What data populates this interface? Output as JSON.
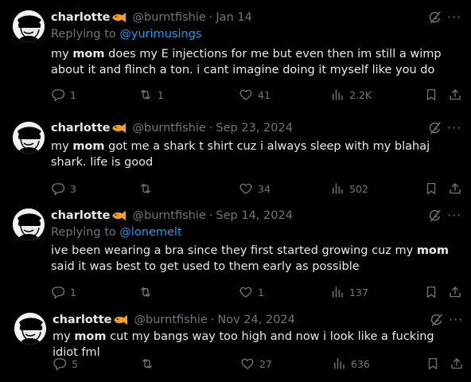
{
  "icons": {
    "reply": "reply-icon",
    "repost": "repost-icon",
    "like": "heart-icon",
    "views": "views-icon",
    "bookmark": "bookmark-icon",
    "share": "share-icon",
    "grok": "grok-icon",
    "more": "more-icon"
  },
  "tweets": [
    {
      "name": "charlotte",
      "handle": "@burntfishie",
      "date": "Jan 14",
      "replying_to_label": "Replying to",
      "replying_to_user": "@yurimusings",
      "text_before": "my ",
      "text_bold": "mom",
      "text_after": " does my E injections for me but even then im still a wimp about it and flinch a ton. i cant imagine doing it myself like you do",
      "replies": "1",
      "reposts": "1",
      "likes": "41",
      "views": "2.2K"
    },
    {
      "name": "charlotte",
      "handle": "@burntfishie",
      "date": "Sep 23, 2024",
      "replying_to_label": "",
      "replying_to_user": "",
      "text_before": "my ",
      "text_bold": "mom",
      "text_after": " got me a shark t shirt cuz i always sleep with my blahaj shark. life is good",
      "replies": "3",
      "reposts": "",
      "likes": "34",
      "views": "502"
    },
    {
      "name": "charlotte",
      "handle": "@burntfishie",
      "date": "Sep 14, 2024",
      "replying_to_label": "Replying to",
      "replying_to_user": "@lonemelt",
      "text_before": "ive been wearing a bra since they first started growing cuz my ",
      "text_bold": "mom",
      "text_after": " said it was best to get used to them early as possible",
      "replies": "1",
      "reposts": "",
      "likes": "1",
      "views": "137"
    },
    {
      "name": "charlotte",
      "handle": "@burntfishie",
      "date": "Nov 24, 2024",
      "replying_to_label": "",
      "replying_to_user": "",
      "text_before": "my ",
      "text_bold": "mom",
      "text_after": " cut my bangs way too high and now i look like a fucking idiot fml",
      "replies": "5",
      "reposts": "",
      "likes": "27",
      "views": "636"
    }
  ]
}
